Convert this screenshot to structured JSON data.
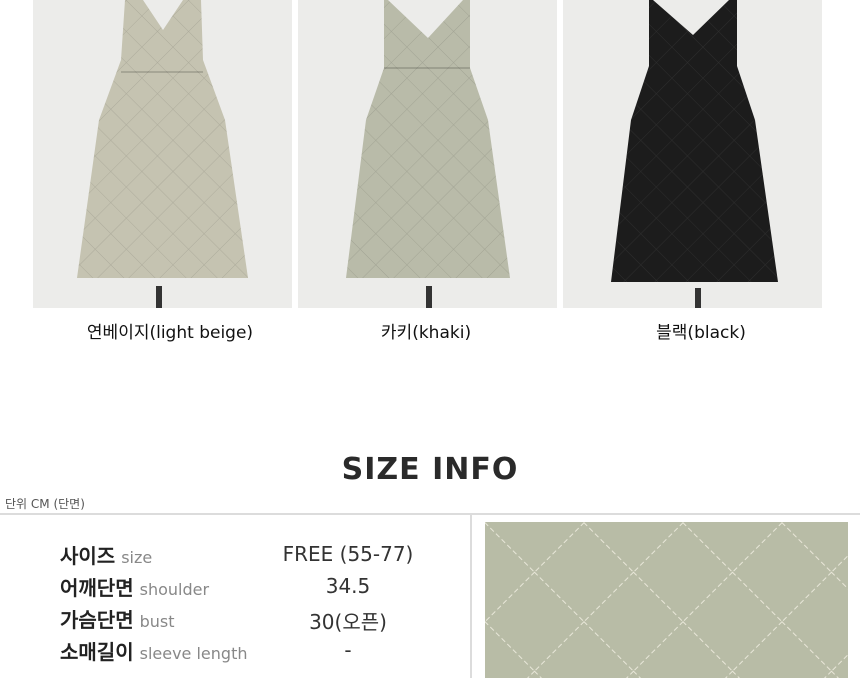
{
  "products": [
    {
      "caption": "연베이지(light beige)",
      "color": "#c5c3b1"
    },
    {
      "caption": "카키(khaki)",
      "color": "#b9bba9"
    },
    {
      "caption": "블랙(black)",
      "color": "#1c1c1c"
    }
  ],
  "size_info": {
    "title": "SIZE INFO",
    "unit_note": "단위 CM (단면)",
    "rows": [
      {
        "ko": "사이즈",
        "en": "size",
        "value": "FREE (55-77)"
      },
      {
        "ko": "어깨단면",
        "en": "shoulder",
        "value": "34.5"
      },
      {
        "ko": "가슴단면",
        "en": "bust",
        "value": "30(오픈)"
      },
      {
        "ko": "소매길이",
        "en": "sleeve length",
        "value": "-"
      }
    ]
  }
}
